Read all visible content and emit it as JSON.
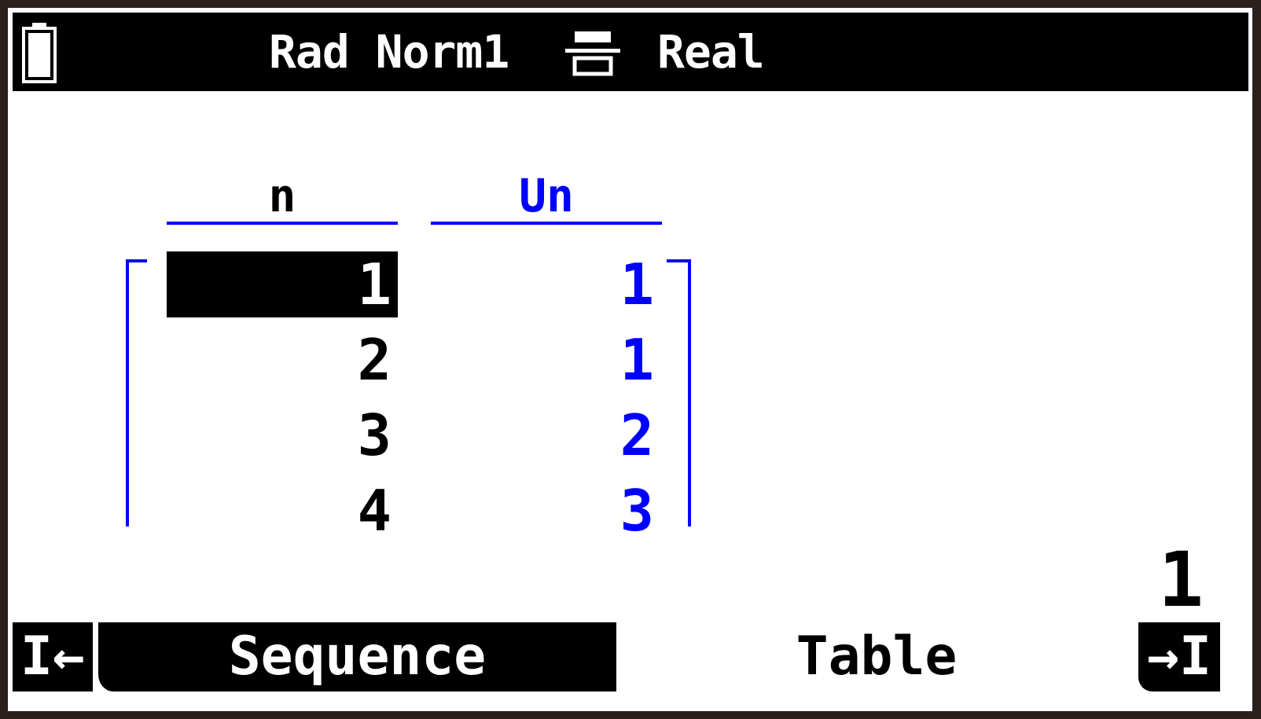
{
  "status": {
    "battery_icon": "battery-full-icon",
    "mode": "Rad Norm1",
    "format_icon": "fraction-display-icon",
    "complex": "Real"
  },
  "table": {
    "columns": [
      "n",
      "Un"
    ],
    "rows": [
      {
        "n": "1",
        "un": "1"
      },
      {
        "n": "2",
        "un": "1"
      },
      {
        "n": "3",
        "un": "2"
      },
      {
        "n": "4",
        "un": "3"
      }
    ],
    "selected_value": "1"
  },
  "fkeys": {
    "left_label": "I←",
    "sequence_label": "Sequence",
    "table_label": "Table",
    "right_label": "→I"
  },
  "colors": {
    "accent": "#0000ff",
    "highlight": "#000000"
  }
}
